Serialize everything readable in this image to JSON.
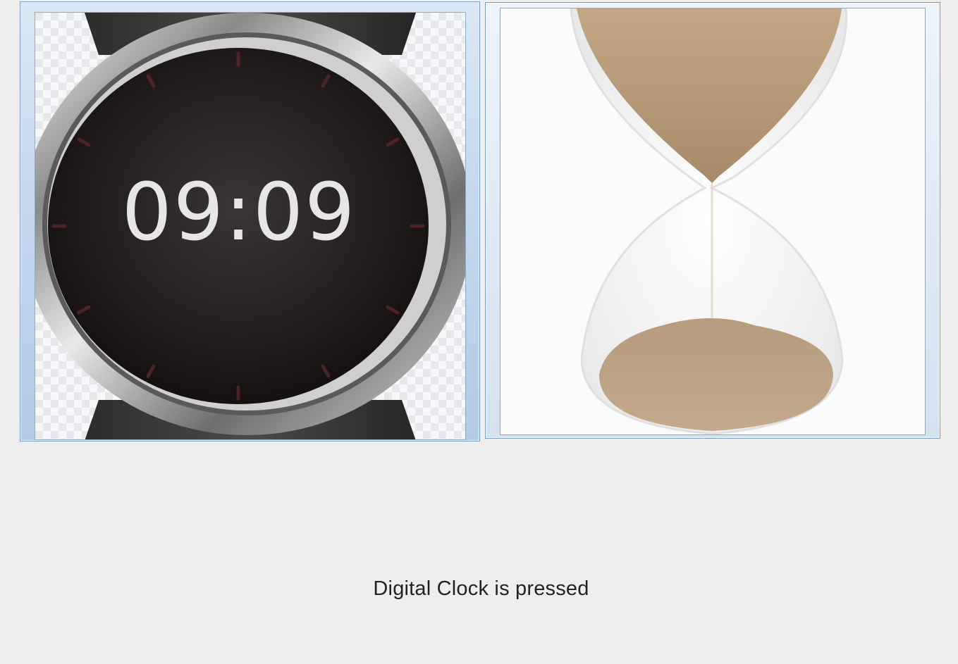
{
  "buttons": {
    "digital_clock": {
      "display_time": "09:09",
      "selected": true
    },
    "hourglass": {
      "selected": false
    }
  },
  "status": {
    "message": "Digital Clock is pressed"
  },
  "colors": {
    "background": "#eeeeee",
    "selected_border": "#7a9ac0",
    "watch_dial": "#241e1e",
    "sand": "#b99a7a"
  },
  "icons": [
    "digital-watch-icon",
    "hourglass-icon"
  ]
}
